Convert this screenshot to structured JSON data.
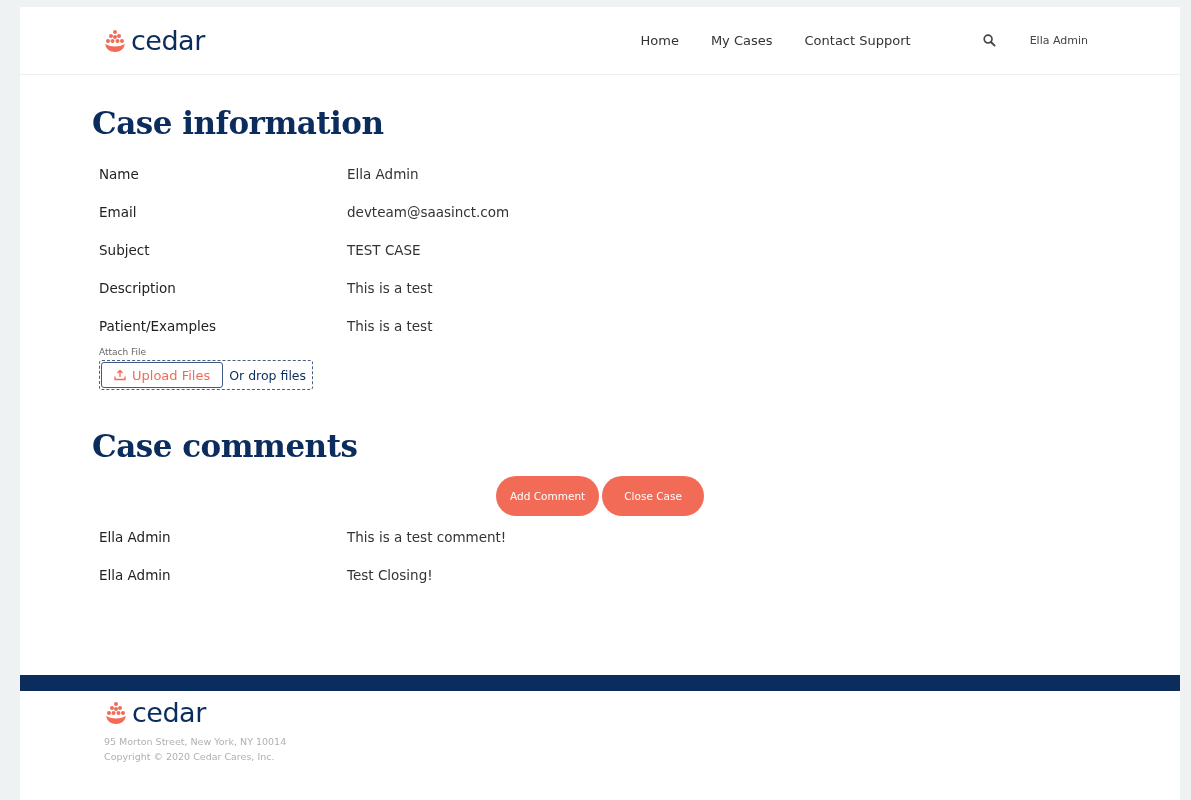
{
  "header": {
    "logo": "cedar",
    "nav": [
      {
        "label": "Home"
      },
      {
        "label": "My Cases"
      },
      {
        "label": "Contact Support"
      }
    ],
    "user": "Ella Admin"
  },
  "case_information": {
    "title": "Case information",
    "fields": [
      {
        "label": "Name",
        "value": "Ella Admin"
      },
      {
        "label": "Email",
        "value": "devteam@saasinct.com"
      },
      {
        "label": "Subject",
        "value": "TEST CASE"
      },
      {
        "label": "Description",
        "value": "This is a test"
      },
      {
        "label": "Patient/Examples",
        "value": "This is a test"
      }
    ],
    "attach": {
      "label": "Attach File",
      "button": "Upload Files",
      "drop_hint": "Or drop files"
    }
  },
  "case_comments": {
    "title": "Case comments",
    "buttons": [
      "Add Comment",
      "Close Case"
    ],
    "comments": [
      {
        "author": "Ella Admin",
        "text": "This is a test comment!"
      },
      {
        "author": "Ella Admin",
        "text": "Test Closing!"
      }
    ]
  },
  "footer": {
    "logo": "cedar",
    "address": "95 Morton Street, New York, NY 10014",
    "copyright": "Copyright © 2020 Cedar Cares, Inc."
  }
}
